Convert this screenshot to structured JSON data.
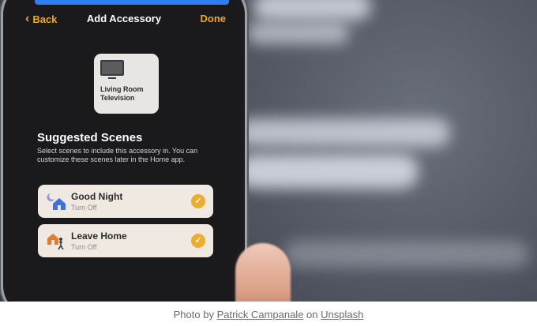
{
  "nav": {
    "back_label": "Back",
    "title": "Add Accessory",
    "done_label": "Done"
  },
  "accessory": {
    "name_line1": "Living Room",
    "name_line2": "Television",
    "icon": "tv-icon"
  },
  "suggested": {
    "title": "Suggested Scenes",
    "description": "Select scenes to include this accessory in. You can customize these scenes later in the Home app."
  },
  "scenes": [
    {
      "name": "Good Night",
      "status": "Turn Off",
      "icon": "moon-house-icon",
      "checked": true
    },
    {
      "name": "Leave Home",
      "status": "Turn Off",
      "icon": "person-leaving-house-icon",
      "checked": true
    }
  ],
  "caption": {
    "prefix": "Photo by",
    "author": "Patrick Campanale",
    "joiner": "on",
    "site": "Unsplash"
  },
  "colors": {
    "accent": "#f0a81e",
    "screen_bg": "#1a1a1c",
    "scene_card": "#efe9e2",
    "check": "#efac2c"
  }
}
